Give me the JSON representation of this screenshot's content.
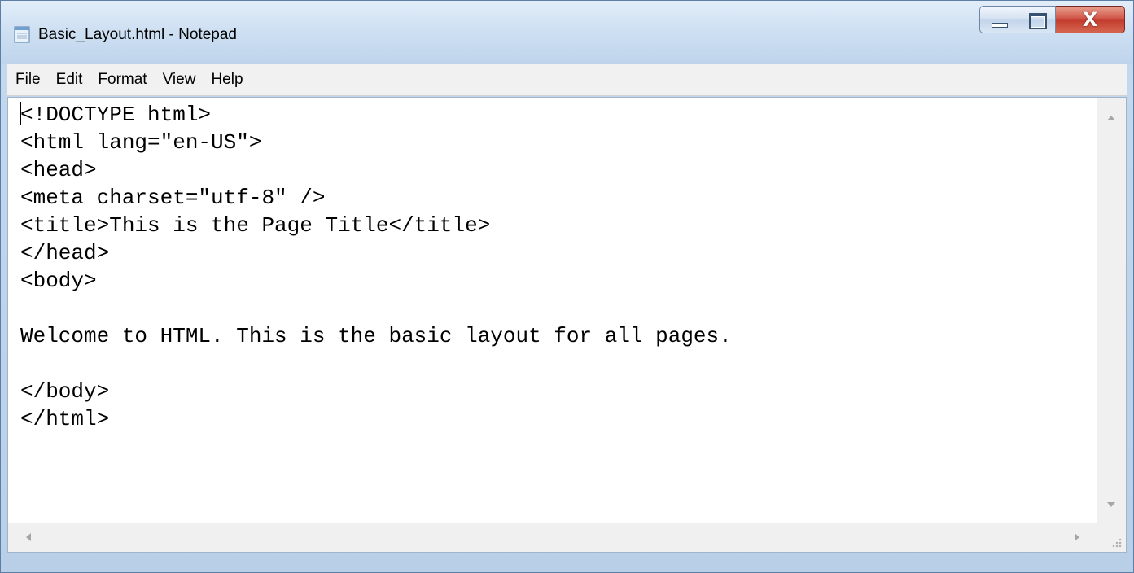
{
  "window": {
    "title": "Basic_Layout.html - Notepad",
    "icon": "notepad-icon",
    "accent_close": "#c13a2c"
  },
  "caption_buttons": {
    "minimize_icon": "minimize-icon",
    "maximize_icon": "maximize-icon",
    "close_label": "X"
  },
  "menu": {
    "items": [
      {
        "accel": "F",
        "rest": "ile"
      },
      {
        "accel": "E",
        "rest": "dit"
      },
      {
        "pre": "F",
        "accel": "o",
        "rest": "rmat"
      },
      {
        "accel": "V",
        "rest": "iew"
      },
      {
        "accel": "H",
        "rest": "elp"
      }
    ]
  },
  "editor": {
    "lines": [
      "<!DOCTYPE html>",
      "<html lang=\"en-US\">",
      "<head>",
      "<meta charset=\"utf-8\" />",
      "<title>This is the Page Title</title>",
      "</head>",
      "<body>",
      "",
      "Welcome to HTML. This is the basic layout for all pages.",
      "",
      "</body>",
      "</html>"
    ]
  }
}
